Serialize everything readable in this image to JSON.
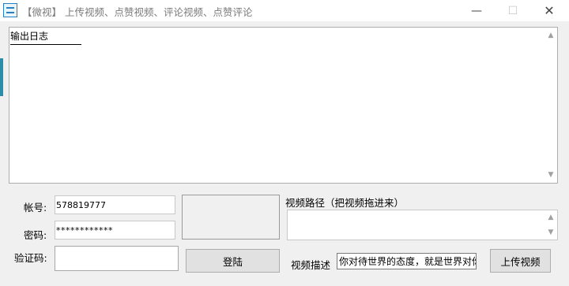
{
  "window": {
    "title": "【微视】 上传视频、点赞视频、评论视频、点赞评论",
    "icon": "app-logo-icon",
    "minimize_glyph": "—",
    "maximize_glyph": "☐",
    "close_glyph": "✕"
  },
  "output": {
    "text": "输出日志"
  },
  "scroll": {
    "up": "▲",
    "down": "▼"
  },
  "login": {
    "account_label": "帐号:",
    "account_value": "578819777",
    "password_label": "密码:",
    "password_value": "************",
    "captcha_label": "验证码:",
    "captcha_value": "",
    "login_button": "登陆"
  },
  "upload": {
    "path_label": "视频路径（把视频拖进来）",
    "path_value": "",
    "desc_label": "视频描述",
    "desc_value": "你对待世界的态度，就是世界对你",
    "upload_button": "上传视频"
  }
}
